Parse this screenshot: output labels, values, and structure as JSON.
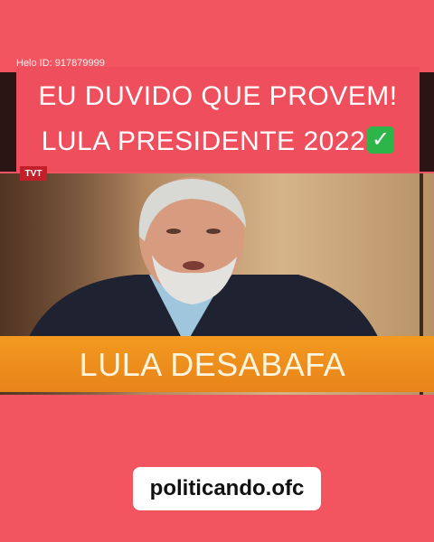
{
  "watermark": "Helo ID: 917879999",
  "headline": {
    "line1": "EU DUVIDO QUE PROVEM!",
    "line2": "LULA PRESIDENTE 2022",
    "emoji_icon": "check-mark-button-icon"
  },
  "tvt_logo": "TVT",
  "banner": "LULA DESABAFA",
  "handle": "politicando.ofc",
  "colors": {
    "background": "#f25560",
    "banner": "#f39a1f",
    "check": "#2db54a"
  }
}
